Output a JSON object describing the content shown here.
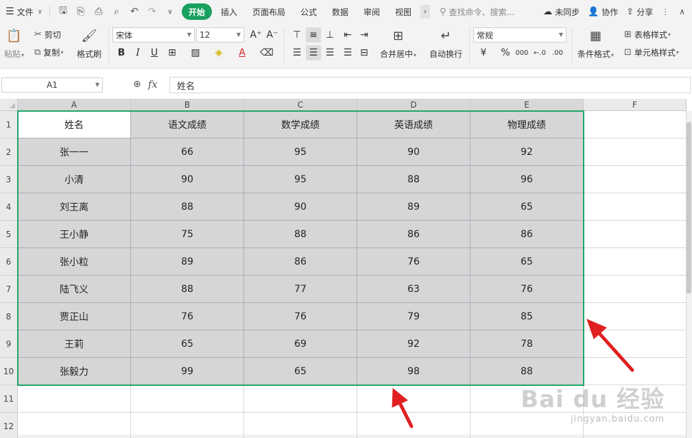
{
  "menubar": {
    "file_label": "文件",
    "tabs": [
      "开始",
      "插入",
      "页面布局",
      "公式",
      "数据",
      "审阅",
      "视图"
    ],
    "search_placeholder": "查找命令、搜索...",
    "sync_label": "未同步",
    "collab_label": "协作",
    "share_label": "分享"
  },
  "ribbon": {
    "paste_label": "粘贴",
    "cut_label": "剪切",
    "copy_label": "复制",
    "format_painter_label": "格式刷",
    "font_name": "宋体",
    "font_size": "12",
    "bold_label": "B",
    "italic_label": "I",
    "underline_label": "U",
    "font_color_label": "A",
    "merge_label": "合并居中",
    "wrap_label": "自动换行",
    "number_format": "常规",
    "currency_label": "¥",
    "percent_label": "%",
    "thousands_label": "000",
    "cond_format_label": "条件格式",
    "table_style_label": "表格样式",
    "cell_style_label": "单元格样式"
  },
  "formula_bar": {
    "name_box": "A1",
    "fx_label": "fx",
    "content": "姓名"
  },
  "sheet": {
    "columns": [
      "A",
      "B",
      "C",
      "D",
      "E",
      "F"
    ],
    "rows": [
      "1",
      "2",
      "3",
      "4",
      "5",
      "6",
      "7",
      "8",
      "9",
      "10",
      "11",
      "12"
    ],
    "cells": [
      [
        "姓名",
        "语文成绩",
        "数学成绩",
        "英语成绩",
        "物理成绩"
      ],
      [
        "张一一",
        "66",
        "95",
        "90",
        "92"
      ],
      [
        "小清",
        "90",
        "95",
        "88",
        "96"
      ],
      [
        "刘王离",
        "88",
        "90",
        "89",
        "65"
      ],
      [
        "王小静",
        "75",
        "88",
        "86",
        "86"
      ],
      [
        "张小粒",
        "89",
        "86",
        "76",
        "65"
      ],
      [
        "陆飞义",
        "88",
        "77",
        "63",
        "76"
      ],
      [
        "贾正山",
        "76",
        "76",
        "79",
        "85"
      ],
      [
        "王莉",
        "65",
        "69",
        "92",
        "78"
      ],
      [
        "张毅力",
        "99",
        "65",
        "98",
        "88"
      ]
    ]
  },
  "colors": {
    "accent_green": "#19a15f",
    "selection_border": "#1da46a",
    "selection_fill": "#d6d6d6",
    "arrow_red": "#e02020"
  },
  "watermark": {
    "line1": "Bai du 经验",
    "line2": "jingyan.baidu.com"
  }
}
